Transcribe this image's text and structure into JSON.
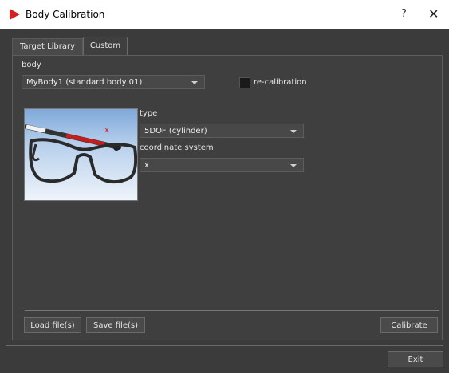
{
  "window": {
    "title": "Body Calibration",
    "help_label": "?",
    "close_label": "✕",
    "app_icon": "red-play-triangle-icon"
  },
  "tabs": [
    {
      "label": "Target Library",
      "active": false
    },
    {
      "label": "Custom",
      "active": true
    }
  ],
  "body_section": {
    "label": "body",
    "selected": "MyBody1 (standard body 01)",
    "recalibration_label": "re-calibration",
    "recalibration_checked": false
  },
  "type_section": {
    "label": "type",
    "selected": "5DOF (cylinder)"
  },
  "coordinate_section": {
    "label": "coordinate system",
    "selected": "x"
  },
  "preview": {
    "axis_marker": "x",
    "icon": "glasses-with-5dof-target-illustration"
  },
  "buttons": {
    "load": "Load file(s)",
    "save": "Save file(s)",
    "calibrate": "Calibrate",
    "exit": "Exit"
  },
  "colors": {
    "background": "#3b3b3b",
    "accent_red": "#d42020"
  }
}
